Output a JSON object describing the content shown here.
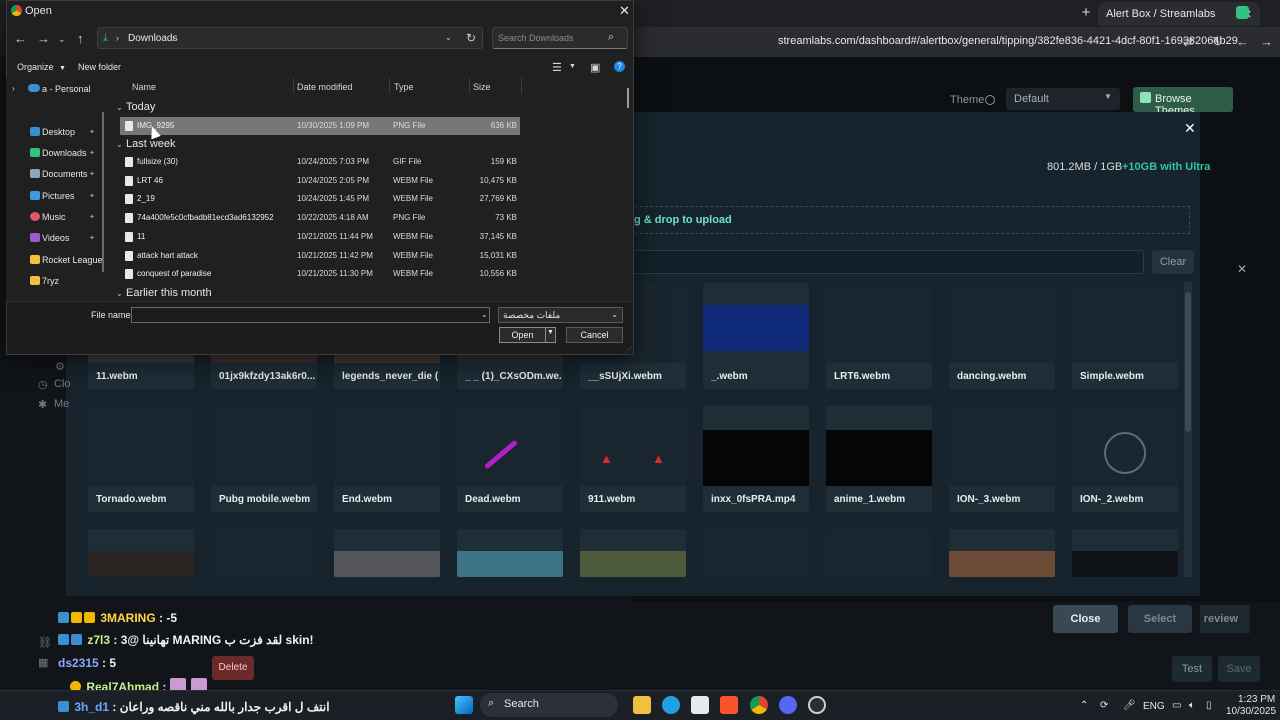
{
  "browser": {
    "tab_title": "Alert Box / Streamlabs",
    "url": "streamlabs.com/dashboard#/alertbox/general/tipping/382fe836-4421-4dcf-80f1-169382064b29"
  },
  "streamlabs": {
    "theme_label": "Theme",
    "theme_value": "Default",
    "browse_themes": "Browse Themes",
    "storage_used": "801.2MB / 1GB",
    "upgrade": "+10GB with Ultra",
    "upload_hint": "g & drop to upload",
    "clear": "Clear",
    "media_row1": [
      "11.webm",
      "01jx9kfzdy13ak6r0...",
      "legends_never_die (...",
      "_ _ (1)_CXsODm.we...",
      "__sSUjXi.webm",
      "_.webm",
      "LRT6.webm",
      "dancing.webm",
      "Simple.webm"
    ],
    "media_row2": [
      "Tornado.webm",
      "Pubg mobile.webm",
      "End.webm",
      "Dead.webm",
      "911.webm",
      "inxx_0fsPRA.mp4",
      "anime_1.webm",
      "ION-_3.webm",
      "ION-_2.webm"
    ],
    "close_btn": "Close",
    "select_btn": "Select",
    "preview_btn": "review",
    "test_btn": "Test",
    "save_btn": "Save",
    "delete_btn": "Delete",
    "left_labels": [
      "Clo",
      "Me"
    ]
  },
  "chat": [
    {
      "user": "3MARING",
      "text": ": -5"
    },
    {
      "user": "z7l3",
      "text": ": 3@ تهانينا MARING لقد فزت ب skin!"
    },
    {
      "user": "ds2315",
      "text": ": 5"
    },
    {
      "user": "Real7Ahmad",
      "text": ":"
    },
    {
      "user": "3h_d1",
      "text": ": انتف ل اقرب جدار بالله مني ناقصه وراعان"
    }
  ],
  "dialog": {
    "title": "Open",
    "path_folder": "Downloads",
    "search_placeholder": "Search Downloads",
    "organize": "Organize",
    "new_folder": "New folder",
    "nav_top": "a - Personal",
    "nav_items": [
      "Desktop",
      "Downloads",
      "Documents",
      "Pictures",
      "Music",
      "Videos",
      "Rocket League",
      "7ryz"
    ],
    "columns": {
      "name": "Name",
      "date": "Date modified",
      "type": "Type",
      "size": "Size"
    },
    "groups": [
      "Today",
      "Last week",
      "Earlier this month"
    ],
    "files": [
      {
        "name": "IMG_9295",
        "date": "10/30/2025 1:09 PM",
        "type": "PNG File",
        "size": "636 KB"
      },
      {
        "name": "fullsize (30)",
        "date": "10/24/2025 7:03 PM",
        "type": "GIF File",
        "size": "159 KB"
      },
      {
        "name": "LRT 46",
        "date": "10/24/2025 2:05 PM",
        "type": "WEBM File",
        "size": "10,475 KB"
      },
      {
        "name": "2_19",
        "date": "10/24/2025 1:45 PM",
        "type": "WEBM File",
        "size": "27,769 KB"
      },
      {
        "name": "74a400fe5c0cfbadb81ecd3ad6132952",
        "date": "10/22/2025 4:18 AM",
        "type": "PNG File",
        "size": "73 KB"
      },
      {
        "name": "11",
        "date": "10/21/2025 11:44 PM",
        "type": "WEBM File",
        "size": "37,145 KB"
      },
      {
        "name": "attack hart attack",
        "date": "10/21/2025 11:42 PM",
        "type": "WEBM File",
        "size": "15,031 KB"
      },
      {
        "name": "conquest of paradise",
        "date": "10/21/2025 11:30 PM",
        "type": "WEBM File",
        "size": "10,556 KB"
      }
    ],
    "file_name_label": "File name:",
    "file_name_value": "",
    "filter": "ملفات مخصصة",
    "open_btn": "Open",
    "cancel_btn": "Cancel"
  },
  "taskbar": {
    "search": "Search",
    "lang": "ENG",
    "time": "1:23 PM",
    "date": "10/30/2025"
  }
}
